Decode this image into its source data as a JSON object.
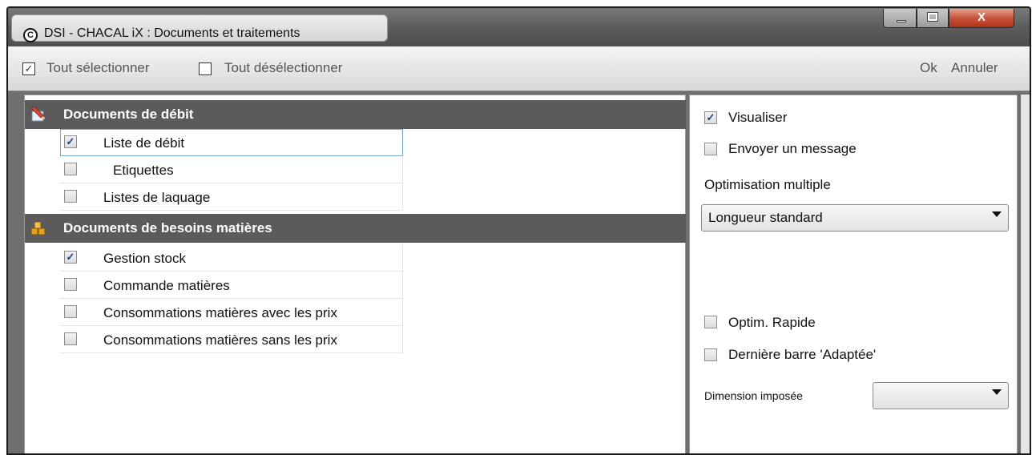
{
  "window": {
    "title": "DSI - CHACAL iX : Documents et traitements",
    "app_icon_glyph": "C",
    "close_glyph": "X"
  },
  "toolbar": {
    "select_all_label": "Tout sélectionner",
    "select_all_checked": true,
    "deselect_all_label": "Tout désélectionner",
    "deselect_all_checked": false,
    "ok_label": "Ok",
    "cancel_label": "Annuler"
  },
  "groups": [
    {
      "label": "Documents de débit",
      "icon": "pencil-document-icon",
      "items": [
        {
          "label": "Liste de débit",
          "checked": true,
          "mark": "✓"
        },
        {
          "label": "Etiquettes",
          "checked": false,
          "mark": ""
        },
        {
          "label": "Listes de laquage",
          "checked": false,
          "mark": ""
        }
      ]
    },
    {
      "label": "Documents de besoins matières",
      "icon": "material-boxes-icon",
      "items": [
        {
          "label": "Gestion stock",
          "checked": true,
          "mark": "✓"
        },
        {
          "label": "Commande matières",
          "checked": false,
          "mark": ""
        },
        {
          "label": "Consommations matières avec les prix",
          "checked": false,
          "mark": ""
        },
        {
          "label": "Consommations matières sans les prix",
          "checked": false,
          "mark": ""
        }
      ]
    }
  ],
  "options": {
    "visualiser_label": "Visualiser",
    "visualiser_checked": true,
    "visualiser_mark": "✓",
    "envoyer_label": "Envoyer un message",
    "envoyer_checked": false,
    "optimisation_label": "Optimisation multiple",
    "optimisation_value": "Longueur standard",
    "optim_rapide_label": "Optim. Rapide",
    "optim_rapide_checked": false,
    "derniere_barre_label": "Dernière barre 'Adaptée'",
    "derniere_barre_checked": false,
    "dimension_label": "Dimension imposée",
    "dimension_value": ""
  },
  "colors": {
    "title_bar": "#5c5c5c",
    "group_header": "#5b5b5b",
    "close_button": "#c8533b",
    "check_mark": "#1e3f8a"
  }
}
